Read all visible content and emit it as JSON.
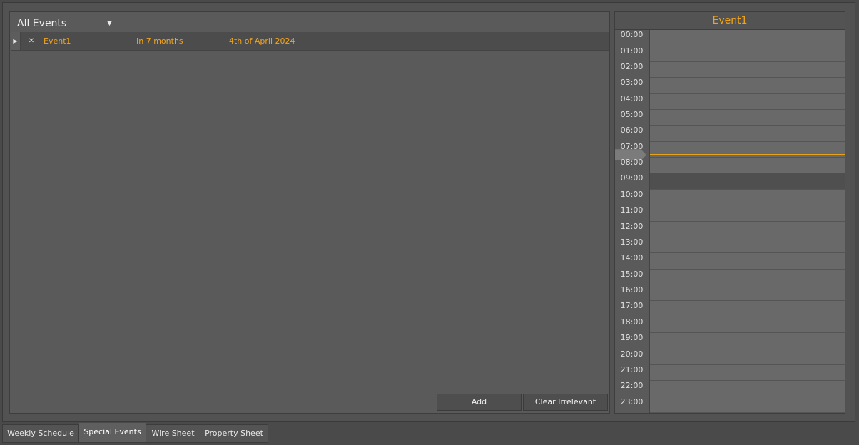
{
  "filter": {
    "selected": "All Events"
  },
  "events": [
    {
      "name": "Event1",
      "when": "In 7 months",
      "date": "4th of April 2024"
    }
  ],
  "buttons": {
    "add": "Add",
    "clear": "Clear Irrelevant"
  },
  "detail": {
    "title": "Event1",
    "hours": [
      "00:00",
      "01:00",
      "02:00",
      "03:00",
      "04:00",
      "05:00",
      "06:00",
      "07:00",
      "08:00",
      "09:00",
      "10:00",
      "11:00",
      "12:00",
      "13:00",
      "14:00",
      "15:00",
      "16:00",
      "17:00",
      "18:00",
      "19:00",
      "20:00",
      "21:00",
      "22:00",
      "23:00"
    ],
    "busy_hour_index": 9,
    "current_time_hours": 7.0
  },
  "tabs": [
    "Weekly Schedule",
    "Special Events",
    "Wire Sheet",
    "Property Sheet"
  ],
  "active_tab_index": 1,
  "colors": {
    "accent": "#f0a41e",
    "now_line": "#e6a31e"
  }
}
